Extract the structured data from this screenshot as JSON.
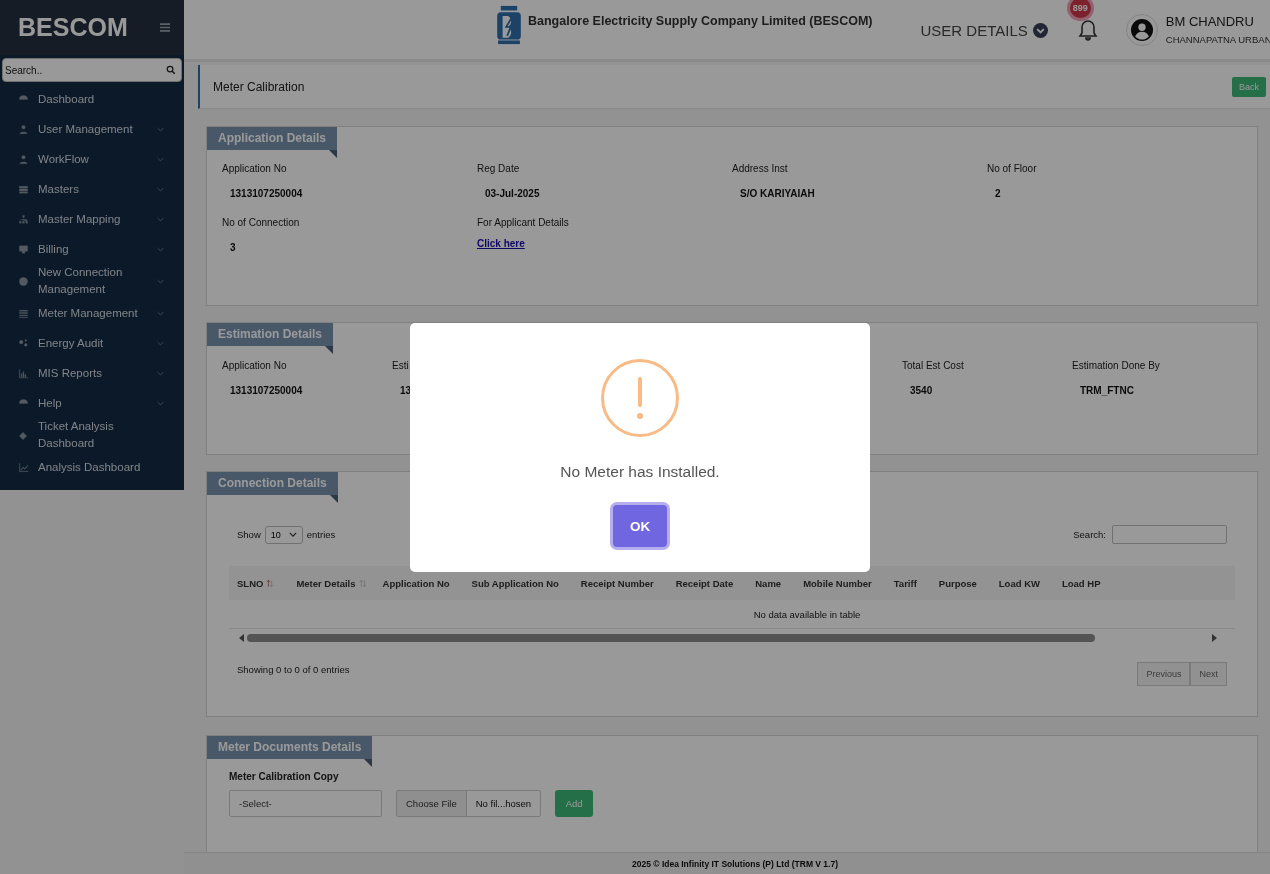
{
  "sidebar": {
    "brand": "BESCOM",
    "search_placeholder": "Search..",
    "items": [
      {
        "label": "Dashboard",
        "expandable": false
      },
      {
        "label": "User Management",
        "expandable": true
      },
      {
        "label": "WorkFlow",
        "expandable": true
      },
      {
        "label": "Masters",
        "expandable": true
      },
      {
        "label": "Master Mapping",
        "expandable": true
      },
      {
        "label": "Billing",
        "expandable": true
      },
      {
        "label": "New Connection Management",
        "expandable": true
      },
      {
        "label": "Meter Management",
        "expandable": true
      },
      {
        "label": "Energy Audit",
        "expandable": true
      },
      {
        "label": "MIS Reports",
        "expandable": true
      },
      {
        "label": "Help",
        "expandable": true
      },
      {
        "label": "Ticket Analysis Dashboard",
        "expandable": false
      },
      {
        "label": "Analysis Dashboard",
        "expandable": false
      }
    ]
  },
  "header": {
    "company": "Bangalore Electricity Supply Company Limited (BESCOM)",
    "user_details": "USER DETAILS",
    "notification_count": "899",
    "user_name": "BM CHANDRU",
    "user_location": "CHANNAPATNA URBAN"
  },
  "page": {
    "title": "Meter Calibration",
    "back": "Back"
  },
  "application_details": {
    "title": "Application Details",
    "fields": [
      {
        "label": "Application No",
        "value": "1313107250004",
        "kind": "text"
      },
      {
        "label": "Reg Date",
        "value": "03-Jul-2025",
        "kind": "text"
      },
      {
        "label": "Address Inst",
        "value": "S/O KARIYAIAH",
        "kind": "text"
      },
      {
        "label": "No of Floor",
        "value": "2",
        "kind": "text"
      },
      {
        "label": "No of Connection",
        "value": "3",
        "kind": "text"
      },
      {
        "label": "For Applicant Details",
        "value": "Click here",
        "kind": "link"
      }
    ]
  },
  "estimation_details": {
    "title": "Estimation Details",
    "fields": [
      {
        "label": "Application No",
        "value": "1313107250004"
      },
      {
        "label": "Esti",
        "value": "13"
      },
      {
        "label": "Total Est Cost",
        "value": "3540"
      },
      {
        "label": "Estimation Done By",
        "value": "TRM_FTNC"
      }
    ]
  },
  "connection_details": {
    "title": "Connection Details",
    "show": "Show",
    "page_size": "10",
    "entries": "entries",
    "search_label": "Search:",
    "columns": [
      {
        "label": "SLNO",
        "sort_active": true
      },
      {
        "label": "Meter Details",
        "sort_active": false
      },
      {
        "label": "Application No"
      },
      {
        "label": "Sub Application No"
      },
      {
        "label": "Receipt Number"
      },
      {
        "label": "Receipt Date"
      },
      {
        "label": "Name"
      },
      {
        "label": "Mobile Number"
      },
      {
        "label": "Tariff"
      },
      {
        "label": "Purpose"
      },
      {
        "label": "Load KW"
      },
      {
        "label": "Load HP"
      }
    ],
    "empty": "No data available in table",
    "info": "Showing 0 to 0 of 0 entries",
    "pager": [
      {
        "label": "Previous",
        "disabled": true
      },
      {
        "label": "Next",
        "disabled": true
      }
    ]
  },
  "meter_documents": {
    "title": "Meter Documents Details",
    "label": "Meter Calibration Copy",
    "select": "-Select-",
    "choose_file": "Choose File",
    "file_name": "No fil...hosen",
    "add": "Add"
  },
  "footer": "2025 © Idea Infinity IT Solutions (P) Ltd (TRM V 1.7)",
  "modal": {
    "message": "No Meter has Installed.",
    "ok": "OK"
  }
}
